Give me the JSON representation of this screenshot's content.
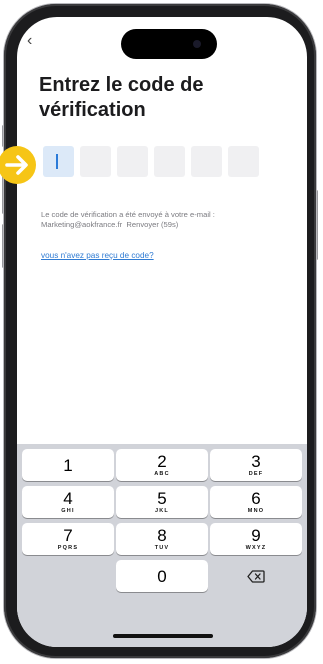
{
  "colors": {
    "accent": "#2f7bd3",
    "marker": "#f6c516",
    "keypad_bg": "#d1d3d9"
  },
  "nav": {
    "back_glyph": "‹"
  },
  "title": "Entrez le code de vérification",
  "code_fields": 6,
  "info": {
    "line1": "Le code de vérification a été envoyé à votre e-mail :",
    "email": "Marketing@aokfrance.fr",
    "resend": "Renvoyer (59s)"
  },
  "help_link": "vous n'avez pas reçu de code?",
  "keypad": {
    "keys": [
      {
        "num": "1",
        "letters": ""
      },
      {
        "num": "2",
        "letters": "ABC"
      },
      {
        "num": "3",
        "letters": "DEF"
      },
      {
        "num": "4",
        "letters": "GHI"
      },
      {
        "num": "5",
        "letters": "JKL"
      },
      {
        "num": "6",
        "letters": "MNO"
      },
      {
        "num": "7",
        "letters": "PQRS"
      },
      {
        "num": "8",
        "letters": "TUV"
      },
      {
        "num": "9",
        "letters": "WXYZ"
      },
      {
        "num": "0",
        "letters": ""
      }
    ],
    "delete_icon": "delete-icon"
  }
}
